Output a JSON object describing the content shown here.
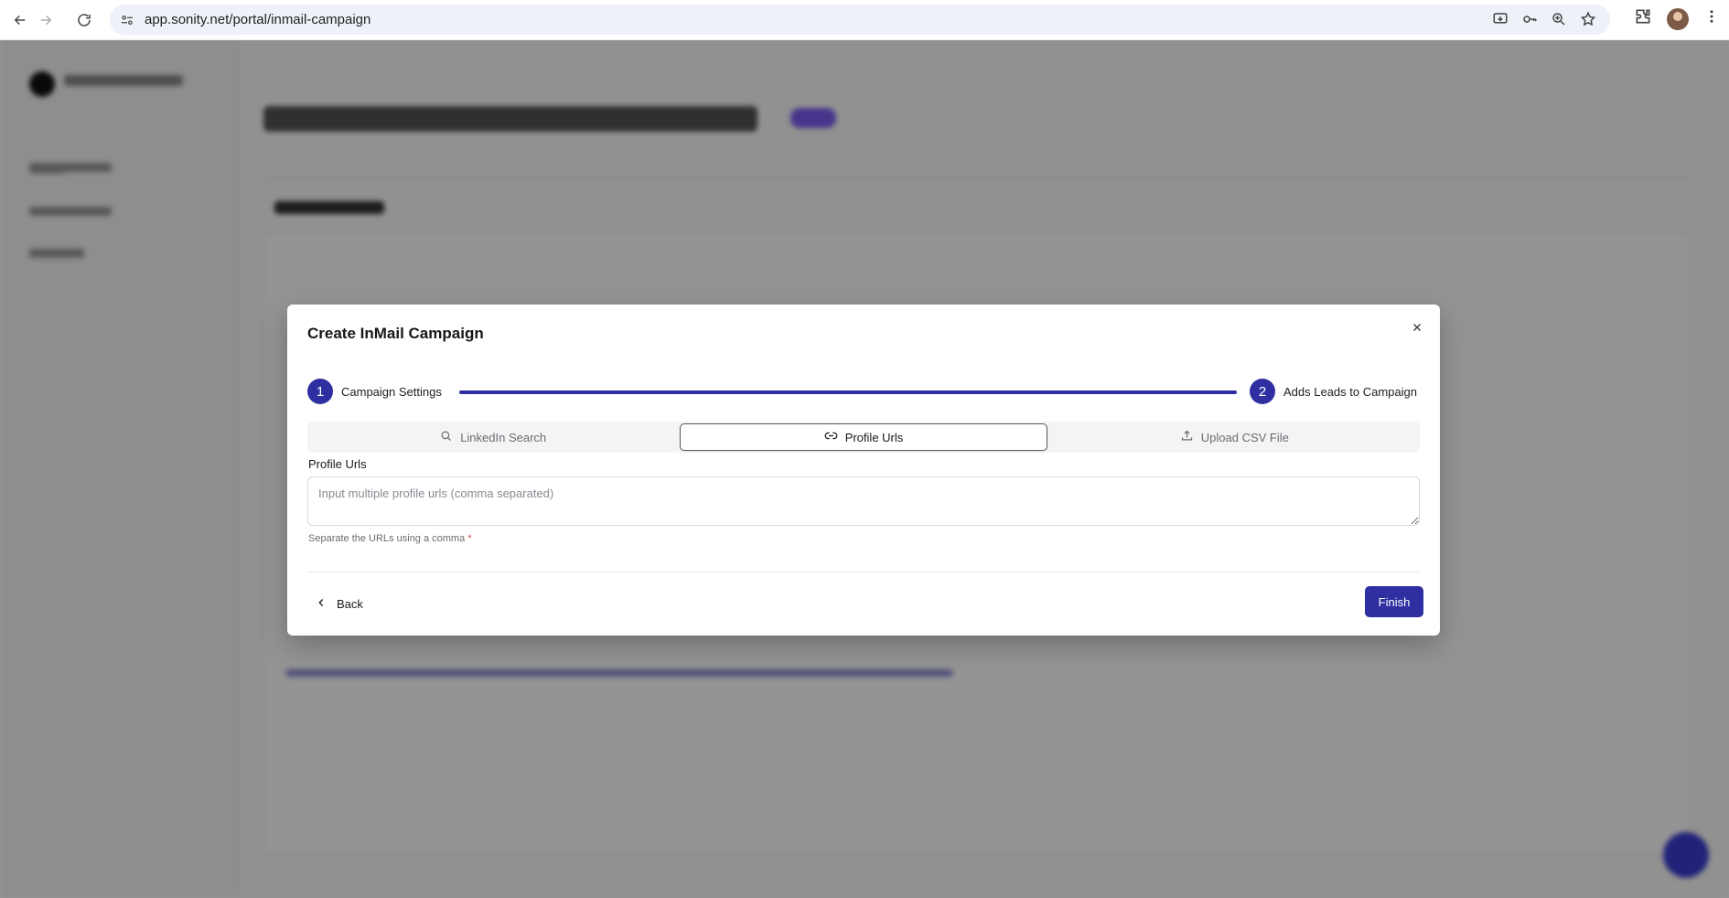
{
  "browser": {
    "url": "app.sonity.net/portal/inmail-campaign",
    "icons": [
      "back-arrow-icon",
      "forward-arrow-icon",
      "reload-icon",
      "site-info-icon",
      "install-app-icon",
      "password-key-icon",
      "zoom-icon",
      "bookmark-star-icon",
      "extensions-icon",
      "profile-avatar",
      "menu-dots-icon"
    ]
  },
  "modal": {
    "title": "Create InMail Campaign",
    "steps": [
      {
        "number": "1",
        "label": "Campaign Settings"
      },
      {
        "number": "2",
        "label": "Adds Leads to Campaign"
      }
    ],
    "tabs": [
      {
        "label": "LinkedIn Search",
        "icon": "search-icon",
        "active": false
      },
      {
        "label": "Profile Urls",
        "icon": "link-icon",
        "active": true
      },
      {
        "label": "Upload CSV File",
        "icon": "upload-icon",
        "active": false
      }
    ],
    "field_label": "Profile Urls",
    "textarea_placeholder": "Input multiple profile urls (comma separated)",
    "helper_text": "Separate the URLs using a comma",
    "helper_required_mark": "*",
    "back_label": "Back",
    "finish_label": "Finish"
  },
  "colors": {
    "primary": "#2f2fa2",
    "overlay": "rgba(0,0,0,0.42)",
    "required": "#e5484d"
  }
}
